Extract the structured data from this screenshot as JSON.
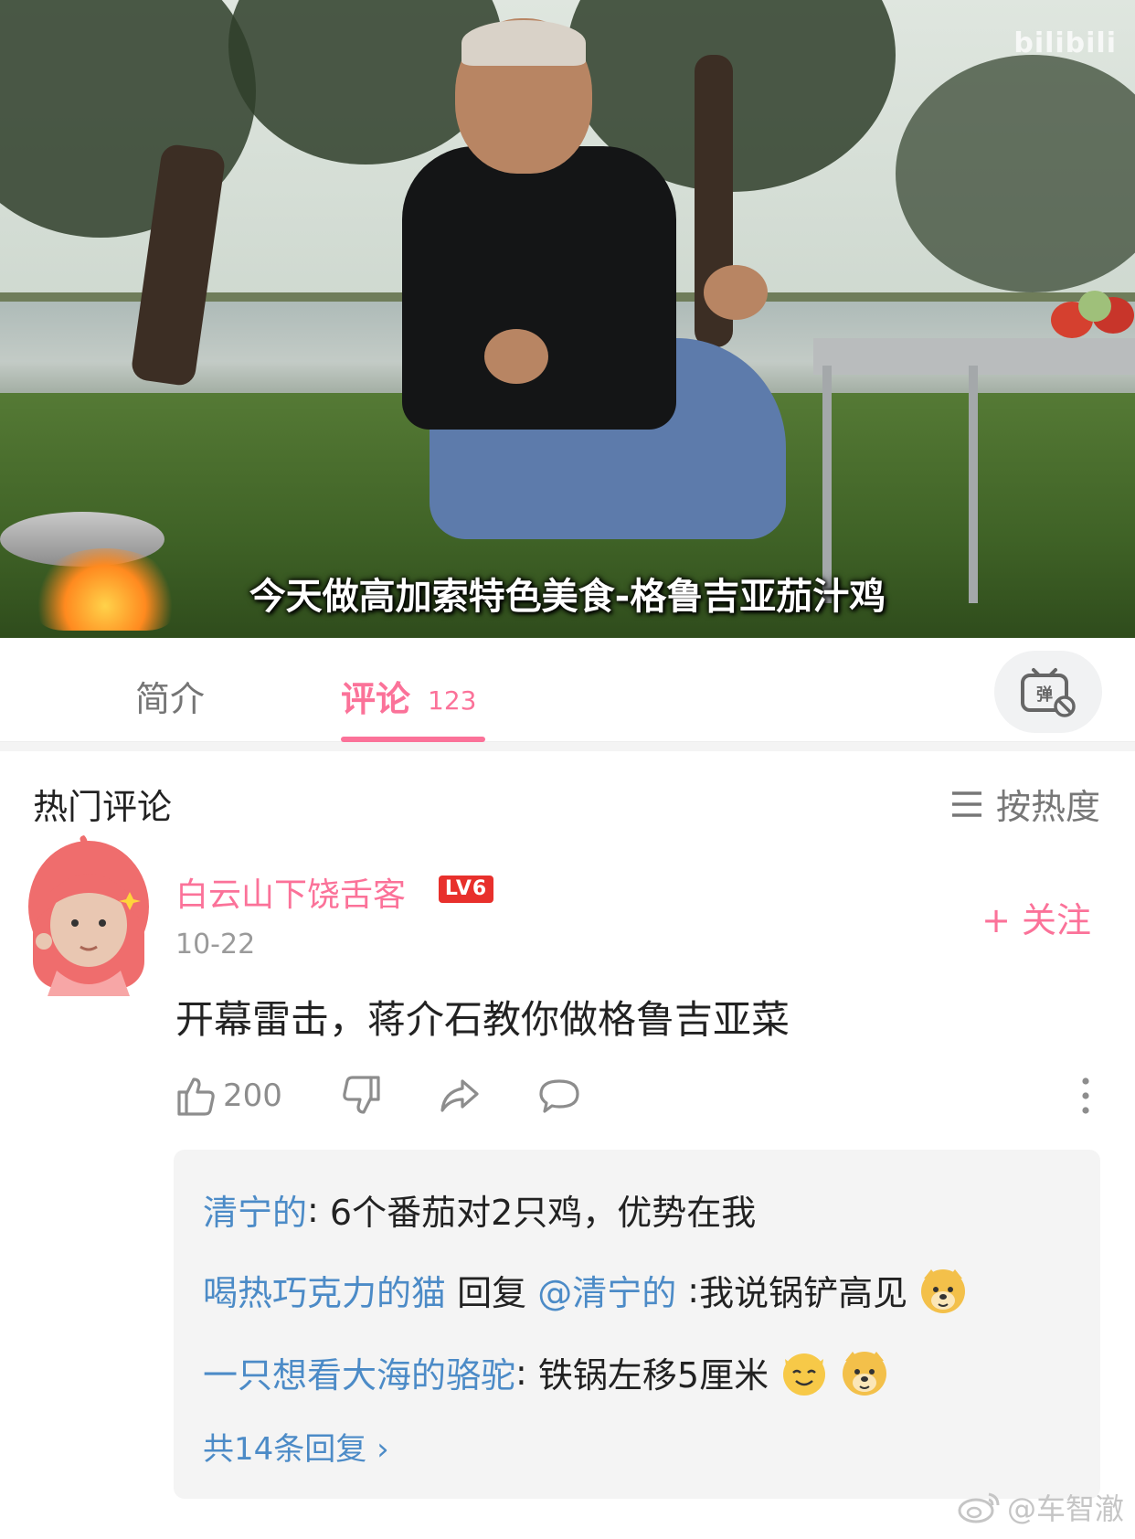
{
  "video": {
    "platform_watermark": "bilibili",
    "subtitle": "今天做高加索特色美食-格鲁吉亚茄汁鸡"
  },
  "tabs": [
    {
      "label": "简介"
    },
    {
      "label": "评论",
      "count": "123",
      "active": true
    }
  ],
  "colors": {
    "accent": "#fb7299",
    "link": "#4c8bc7",
    "level_badge": "#e8302c"
  },
  "hot_comments": {
    "title": "热门评论",
    "sort_label": "按热度"
  },
  "comment": {
    "username": "白云山下饶舌客",
    "level": "LV6",
    "date": "10-22",
    "follow_label": "+ 关注",
    "text": "开幕雷击，蒋介石教你做格鲁吉亚菜",
    "likes": "200"
  },
  "replies": [
    {
      "user": "清宁的",
      "separator": ": ",
      "text": "6个番茄对2只鸡，优势在我"
    },
    {
      "user": "喝热巧克力的猫",
      "reply_word": " 回复 ",
      "mention": "@清宁的",
      "separator": " :",
      "text": "我说锅铲高见",
      "emojis": [
        "doge-emoji"
      ]
    },
    {
      "user": "一只想看大海的骆驼",
      "separator": ": ",
      "text": "铁锅左移5厘米",
      "emojis": [
        "cat-smile-emoji",
        "doge-emoji"
      ]
    }
  ],
  "more_replies_label": "共14条回复 ›",
  "footer_watermark": "@车智澈"
}
